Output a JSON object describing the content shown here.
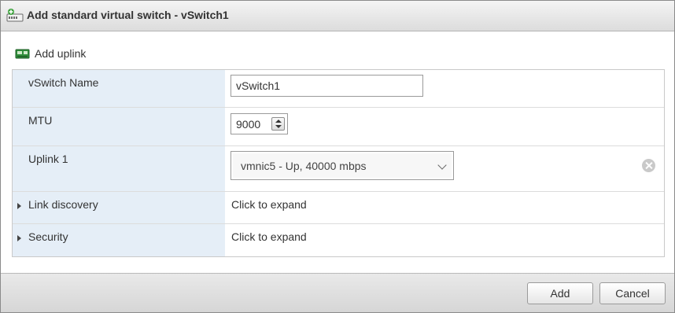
{
  "dialog": {
    "title": "Add standard virtual switch - vSwitch1",
    "title_icon": "virtual-switch-add-icon"
  },
  "toolbar": {
    "add_uplink_label": "Add uplink",
    "add_uplink_icon": "nic-add-icon"
  },
  "form": {
    "vswitch_name": {
      "label": "vSwitch Name",
      "value": "vSwitch1"
    },
    "mtu": {
      "label": "MTU",
      "value": "9000"
    },
    "uplink1": {
      "label": "Uplink 1",
      "value": "vmnic5 - Up, 40000 mbps"
    },
    "link_discovery": {
      "label": "Link discovery",
      "value": "Click to expand"
    },
    "security": {
      "label": "Security",
      "value": "Click to expand"
    }
  },
  "footer": {
    "add_label": "Add",
    "cancel_label": "Cancel"
  },
  "colors": {
    "label_column_bg": "#e5eef7",
    "titlebar_bg": "#dcdcdc",
    "footer_bg": "#d6d6d6"
  }
}
